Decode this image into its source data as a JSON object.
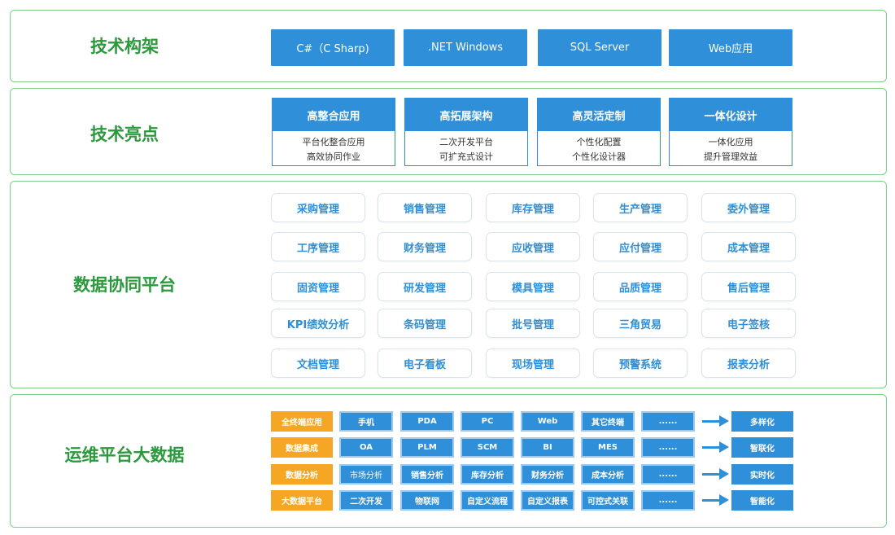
{
  "colors": {
    "title": "#2a9a3c",
    "blue": "#2f8fd8",
    "orange": "#f5a623",
    "panel_border": "#7fcf8f"
  },
  "section1": {
    "title": "技术构架",
    "boxes": [
      "C#（C Sharp)",
      ".NET Windows",
      "SQL Server",
      "Web应用"
    ]
  },
  "section2": {
    "title": "技术亮点",
    "cards": [
      {
        "head": "高整合应用",
        "lines": [
          "平台化整合应用",
          "高效协同作业"
        ]
      },
      {
        "head": "高拓展架构",
        "lines": [
          "二次开发平台",
          "可扩充式设计"
        ]
      },
      {
        "head": "高灵活定制",
        "lines": [
          "个性化配置",
          "个性化设计器"
        ]
      },
      {
        "head": "一体化设计",
        "lines": [
          "一体化应用",
          "提升管理效益"
        ]
      }
    ]
  },
  "section3": {
    "title": "数据协同平台",
    "rows": [
      [
        "采购管理",
        "销售管理",
        "库存管理",
        "生产管理",
        "委外管理"
      ],
      [
        "工序管理",
        "财务管理",
        "应收管理",
        "应付管理",
        "成本管理"
      ],
      [
        "固资管理",
        "研发管理",
        "模具管理",
        "品质管理",
        "售后管理"
      ],
      [
        "KPI绩效分析",
        "条码管理",
        "批号管理",
        "三角贸易",
        "电子签核"
      ],
      [
        "文档管理",
        "电子看板",
        "现场管理",
        "预警系统",
        "报表分析"
      ]
    ]
  },
  "section4": {
    "title": "运维平台大数据",
    "rows": [
      {
        "label": "全终端应用",
        "cells": [
          "手机",
          "PDA",
          "PC",
          "Web",
          "其它终端",
          "......"
        ],
        "result": "多样化"
      },
      {
        "label": "数据集成",
        "cells": [
          "OA",
          "PLM",
          "SCM",
          "BI",
          "MES",
          "......"
        ],
        "result": "智联化"
      },
      {
        "label": "数据分析",
        "cells": [
          "市场分析",
          "销售分析",
          "库存分析",
          "财务分析",
          "成本分析",
          "......"
        ],
        "result": "实时化"
      },
      {
        "label": "大数据平台",
        "cells": [
          "二次开发",
          "物联网",
          "自定义流程",
          "自定义报表",
          "可控式关联",
          "......"
        ],
        "result": "智能化"
      }
    ]
  }
}
